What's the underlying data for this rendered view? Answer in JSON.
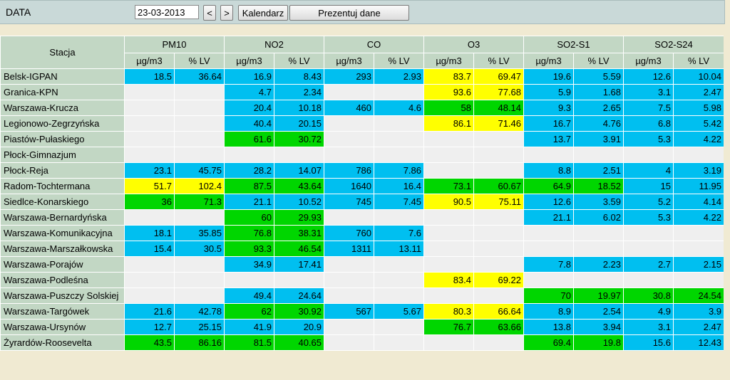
{
  "toolbar": {
    "date_label": "DATA",
    "date_value": "23-03-2013",
    "prev_label": "<",
    "next_label": ">",
    "calendar_label": "Kalendarz",
    "present_label": "Prezentuj dane"
  },
  "colors": {
    "b": "#00bff0",
    "g": "#00d600",
    "y": "#ffff00",
    "e": "#efefef",
    "header": "#c2d7c4"
  },
  "table": {
    "station_header": "Stacja",
    "pollutants": [
      "PM10",
      "NO2",
      "CO",
      "O3",
      "SO2-S1",
      "SO2-S24"
    ],
    "unit_labels": [
      "µg/m3",
      "% LV"
    ],
    "rows": [
      {
        "station": "Belsk-IGPAN",
        "cells": [
          [
            "18.5",
            "b"
          ],
          [
            "36.64",
            "b"
          ],
          [
            "16.9",
            "b"
          ],
          [
            "8.43",
            "b"
          ],
          [
            "293",
            "b"
          ],
          [
            "2.93",
            "b"
          ],
          [
            "83.7",
            "y"
          ],
          [
            "69.47",
            "y"
          ],
          [
            "19.6",
            "b"
          ],
          [
            "5.59",
            "b"
          ],
          [
            "12.6",
            "b"
          ],
          [
            "10.04",
            "b"
          ]
        ]
      },
      {
        "station": "Granica-KPN",
        "cells": [
          [
            "",
            "e"
          ],
          [
            "",
            "e"
          ],
          [
            "4.7",
            "b"
          ],
          [
            "2.34",
            "b"
          ],
          [
            "",
            "e"
          ],
          [
            "",
            "e"
          ],
          [
            "93.6",
            "y"
          ],
          [
            "77.68",
            "y"
          ],
          [
            "5.9",
            "b"
          ],
          [
            "1.68",
            "b"
          ],
          [
            "3.1",
            "b"
          ],
          [
            "2.47",
            "b"
          ]
        ]
      },
      {
        "station": "Warszawa-Krucza",
        "cells": [
          [
            "",
            "e"
          ],
          [
            "",
            "e"
          ],
          [
            "20.4",
            "b"
          ],
          [
            "10.18",
            "b"
          ],
          [
            "460",
            "b"
          ],
          [
            "4.6",
            "b"
          ],
          [
            "58",
            "g"
          ],
          [
            "48.14",
            "g"
          ],
          [
            "9.3",
            "b"
          ],
          [
            "2.65",
            "b"
          ],
          [
            "7.5",
            "b"
          ],
          [
            "5.98",
            "b"
          ]
        ]
      },
      {
        "station": "Legionowo-Zegrzyńska",
        "cells": [
          [
            "",
            "e"
          ],
          [
            "",
            "e"
          ],
          [
            "40.4",
            "b"
          ],
          [
            "20.15",
            "b"
          ],
          [
            "",
            "e"
          ],
          [
            "",
            "e"
          ],
          [
            "86.1",
            "y"
          ],
          [
            "71.46",
            "y"
          ],
          [
            "16.7",
            "b"
          ],
          [
            "4.76",
            "b"
          ],
          [
            "6.8",
            "b"
          ],
          [
            "5.42",
            "b"
          ]
        ]
      },
      {
        "station": "Piastów-Pułaskiego",
        "cells": [
          [
            "",
            "e"
          ],
          [
            "",
            "e"
          ],
          [
            "61.6",
            "g"
          ],
          [
            "30.72",
            "g"
          ],
          [
            "",
            "e"
          ],
          [
            "",
            "e"
          ],
          [
            "",
            "e"
          ],
          [
            "",
            "e"
          ],
          [
            "13.7",
            "b"
          ],
          [
            "3.91",
            "b"
          ],
          [
            "5.3",
            "b"
          ],
          [
            "4.22",
            "b"
          ]
        ]
      },
      {
        "station": "Płock-Gimnazjum",
        "cells": [
          [
            "",
            "e"
          ],
          [
            "",
            "e"
          ],
          [
            "",
            "e"
          ],
          [
            "",
            "e"
          ],
          [
            "",
            "e"
          ],
          [
            "",
            "e"
          ],
          [
            "",
            "e"
          ],
          [
            "",
            "e"
          ],
          [
            "",
            "e"
          ],
          [
            "",
            "e"
          ],
          [
            "",
            "e"
          ],
          [
            "",
            "e"
          ]
        ]
      },
      {
        "station": "Płock-Reja",
        "cells": [
          [
            "23.1",
            "b"
          ],
          [
            "45.75",
            "b"
          ],
          [
            "28.2",
            "b"
          ],
          [
            "14.07",
            "b"
          ],
          [
            "786",
            "b"
          ],
          [
            "7.86",
            "b"
          ],
          [
            "",
            "e"
          ],
          [
            "",
            "e"
          ],
          [
            "8.8",
            "b"
          ],
          [
            "2.51",
            "b"
          ],
          [
            "4",
            "b"
          ],
          [
            "3.19",
            "b"
          ]
        ]
      },
      {
        "station": "Radom-Tochtermana",
        "cells": [
          [
            "51.7",
            "y"
          ],
          [
            "102.4",
            "y"
          ],
          [
            "87.5",
            "g"
          ],
          [
            "43.64",
            "g"
          ],
          [
            "1640",
            "b"
          ],
          [
            "16.4",
            "b"
          ],
          [
            "73.1",
            "g"
          ],
          [
            "60.67",
            "g"
          ],
          [
            "64.9",
            "g"
          ],
          [
            "18.52",
            "g"
          ],
          [
            "15",
            "b"
          ],
          [
            "11.95",
            "b"
          ]
        ]
      },
      {
        "station": "Siedlce-Konarskiego",
        "cells": [
          [
            "36",
            "g"
          ],
          [
            "71.3",
            "g"
          ],
          [
            "21.1",
            "b"
          ],
          [
            "10.52",
            "b"
          ],
          [
            "745",
            "b"
          ],
          [
            "7.45",
            "b"
          ],
          [
            "90.5",
            "y"
          ],
          [
            "75.11",
            "y"
          ],
          [
            "12.6",
            "b"
          ],
          [
            "3.59",
            "b"
          ],
          [
            "5.2",
            "b"
          ],
          [
            "4.14",
            "b"
          ]
        ]
      },
      {
        "station": "Warszawa-Bernardyńska",
        "cells": [
          [
            "",
            "e"
          ],
          [
            "",
            "e"
          ],
          [
            "60",
            "g"
          ],
          [
            "29.93",
            "g"
          ],
          [
            "",
            "e"
          ],
          [
            "",
            "e"
          ],
          [
            "",
            "e"
          ],
          [
            "",
            "e"
          ],
          [
            "21.1",
            "b"
          ],
          [
            "6.02",
            "b"
          ],
          [
            "5.3",
            "b"
          ],
          [
            "4.22",
            "b"
          ]
        ]
      },
      {
        "station": "Warszawa-Komunikacyjna",
        "cells": [
          [
            "18.1",
            "b"
          ],
          [
            "35.85",
            "b"
          ],
          [
            "76.8",
            "g"
          ],
          [
            "38.31",
            "g"
          ],
          [
            "760",
            "b"
          ],
          [
            "7.6",
            "b"
          ],
          [
            "",
            "e"
          ],
          [
            "",
            "e"
          ],
          [
            "",
            "e"
          ],
          [
            "",
            "e"
          ],
          [
            "",
            "e"
          ],
          [
            "",
            "e"
          ]
        ]
      },
      {
        "station": "Warszawa-Marszałkowska",
        "cells": [
          [
            "15.4",
            "b"
          ],
          [
            "30.5",
            "b"
          ],
          [
            "93.3",
            "g"
          ],
          [
            "46.54",
            "g"
          ],
          [
            "1311",
            "b"
          ],
          [
            "13.11",
            "b"
          ],
          [
            "",
            "e"
          ],
          [
            "",
            "e"
          ],
          [
            "",
            "e"
          ],
          [
            "",
            "e"
          ],
          [
            "",
            "e"
          ],
          [
            "",
            "e"
          ]
        ]
      },
      {
        "station": "Warszawa-Porajów",
        "cells": [
          [
            "",
            "e"
          ],
          [
            "",
            "e"
          ],
          [
            "34.9",
            "b"
          ],
          [
            "17.41",
            "b"
          ],
          [
            "",
            "e"
          ],
          [
            "",
            "e"
          ],
          [
            "",
            "e"
          ],
          [
            "",
            "e"
          ],
          [
            "7.8",
            "b"
          ],
          [
            "2.23",
            "b"
          ],
          [
            "2.7",
            "b"
          ],
          [
            "2.15",
            "b"
          ]
        ]
      },
      {
        "station": "Warszawa-Podleśna",
        "cells": [
          [
            "",
            "e"
          ],
          [
            "",
            "e"
          ],
          [
            "",
            "e"
          ],
          [
            "",
            "e"
          ],
          [
            "",
            "e"
          ],
          [
            "",
            "e"
          ],
          [
            "83.4",
            "y"
          ],
          [
            "69.22",
            "y"
          ],
          [
            "",
            "e"
          ],
          [
            "",
            "e"
          ],
          [
            "",
            "e"
          ],
          [
            "",
            "e"
          ]
        ]
      },
      {
        "station": "Warszawa-Puszczy Solskiej",
        "cells": [
          [
            "",
            "e"
          ],
          [
            "",
            "e"
          ],
          [
            "49.4",
            "b"
          ],
          [
            "24.64",
            "b"
          ],
          [
            "",
            "e"
          ],
          [
            "",
            "e"
          ],
          [
            "",
            "e"
          ],
          [
            "",
            "e"
          ],
          [
            "70",
            "g"
          ],
          [
            "19.97",
            "g"
          ],
          [
            "30.8",
            "g"
          ],
          [
            "24.54",
            "g"
          ]
        ]
      },
      {
        "station": "Warszawa-Targówek",
        "cells": [
          [
            "21.6",
            "b"
          ],
          [
            "42.78",
            "b"
          ],
          [
            "62",
            "g"
          ],
          [
            "30.92",
            "g"
          ],
          [
            "567",
            "b"
          ],
          [
            "5.67",
            "b"
          ],
          [
            "80.3",
            "y"
          ],
          [
            "66.64",
            "y"
          ],
          [
            "8.9",
            "b"
          ],
          [
            "2.54",
            "b"
          ],
          [
            "4.9",
            "b"
          ],
          [
            "3.9",
            "b"
          ]
        ]
      },
      {
        "station": "Warszawa-Ursynów",
        "cells": [
          [
            "12.7",
            "b"
          ],
          [
            "25.15",
            "b"
          ],
          [
            "41.9",
            "b"
          ],
          [
            "20.9",
            "b"
          ],
          [
            "",
            "e"
          ],
          [
            "",
            "e"
          ],
          [
            "76.7",
            "g"
          ],
          [
            "63.66",
            "g"
          ],
          [
            "13.8",
            "b"
          ],
          [
            "3.94",
            "b"
          ],
          [
            "3.1",
            "b"
          ],
          [
            "2.47",
            "b"
          ]
        ]
      },
      {
        "station": "Żyrardów-Roosevelta",
        "cells": [
          [
            "43.5",
            "g"
          ],
          [
            "86.16",
            "g"
          ],
          [
            "81.5",
            "g"
          ],
          [
            "40.65",
            "g"
          ],
          [
            "",
            "e"
          ],
          [
            "",
            "e"
          ],
          [
            "",
            "e"
          ],
          [
            "",
            "e"
          ],
          [
            "69.4",
            "g"
          ],
          [
            "19.8",
            "g"
          ],
          [
            "15.6",
            "b"
          ],
          [
            "12.43",
            "b"
          ]
        ]
      }
    ]
  }
}
